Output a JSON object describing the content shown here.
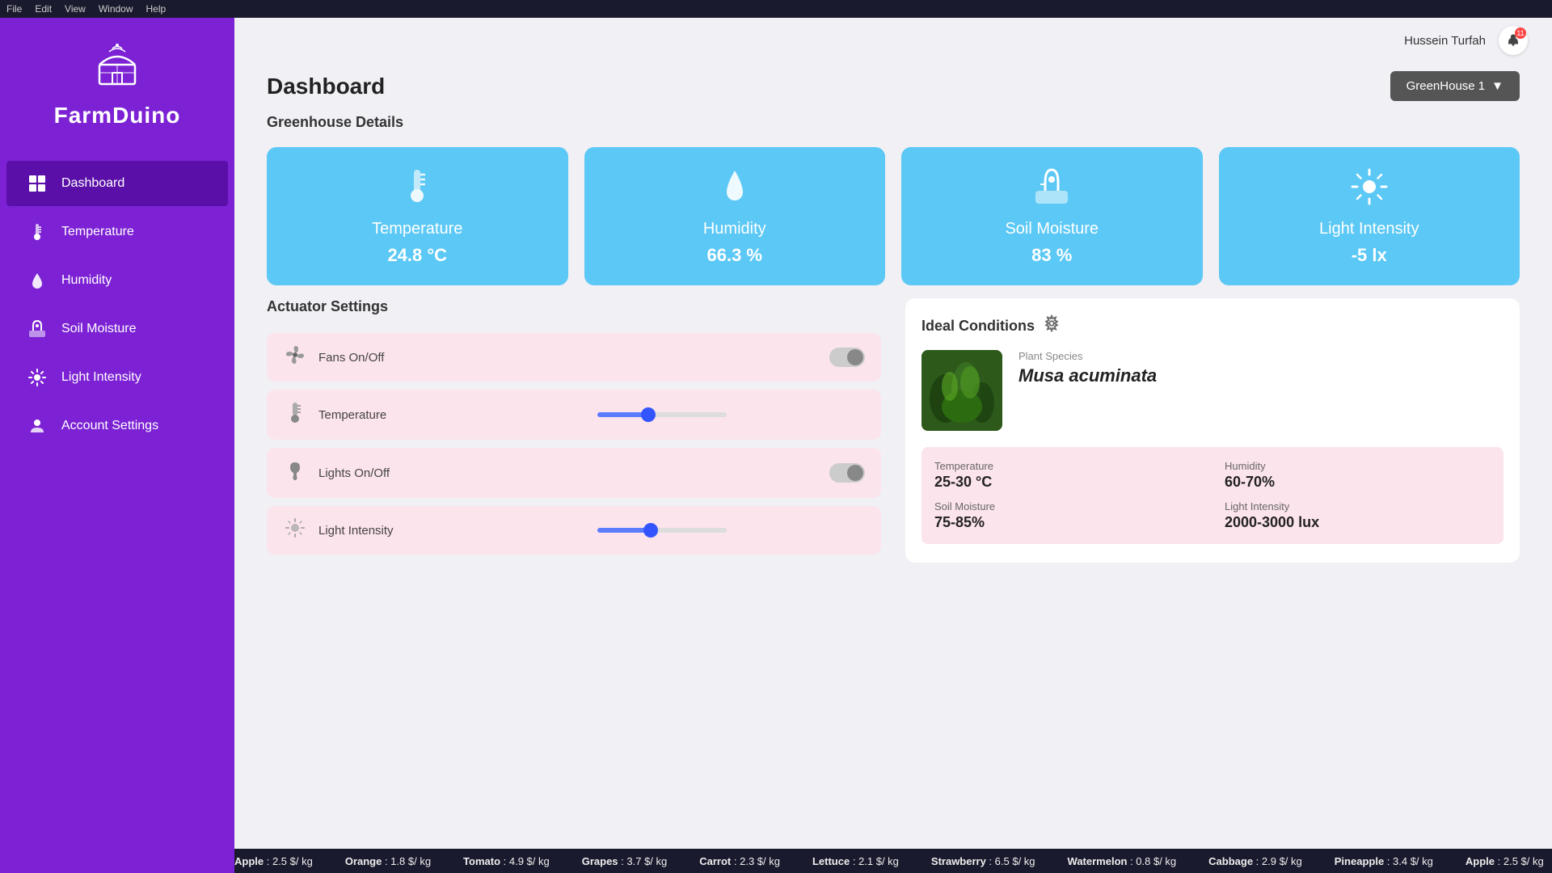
{
  "menubar": {
    "items": [
      "File",
      "Edit",
      "View",
      "Window",
      "Help"
    ]
  },
  "sidebar": {
    "logo_icon": "🏭",
    "logo_text": "FarmDuino",
    "nav_items": [
      {
        "id": "dashboard",
        "label": "Dashboard",
        "icon": "⊞",
        "active": true
      },
      {
        "id": "temperature",
        "label": "Temperature",
        "icon": "🌡",
        "active": false
      },
      {
        "id": "humidity",
        "label": "Humidity",
        "icon": "💧",
        "active": false
      },
      {
        "id": "soil-moisture",
        "label": "Soil Moisture",
        "icon": "🌱",
        "active": false
      },
      {
        "id": "light-intensity",
        "label": "Light Intensity",
        "icon": "💡",
        "active": false
      },
      {
        "id": "account-settings",
        "label": "Account Settings",
        "icon": "👤",
        "active": false
      }
    ]
  },
  "topbar": {
    "user_name": "Hussein Turfah",
    "notifications_count": "11"
  },
  "dashboard": {
    "page_title": "Dashboard",
    "greenhouse_selector": "GreenHouse 1",
    "greenhouse_details_title": "Greenhouse Details",
    "metric_cards": [
      {
        "id": "temperature",
        "label": "Temperature",
        "value": "24.8 °C",
        "icon": "🌡"
      },
      {
        "id": "humidity",
        "label": "Humidity",
        "value": "66.3 %",
        "icon": "💧"
      },
      {
        "id": "soil-moisture",
        "label": "Soil Moisture",
        "value": "83 %",
        "icon": "🌿"
      },
      {
        "id": "light-intensity",
        "label": "Light Intensity",
        "value": "-5 lx",
        "icon": "☀"
      }
    ],
    "actuator_settings_title": "Actuator Settings",
    "actuator_controls": [
      {
        "id": "fans",
        "label": "Fans On/Off",
        "type": "toggle",
        "icon": "fan"
      },
      {
        "id": "temperature-ctrl",
        "label": "Temperature",
        "type": "slider",
        "icon": "thermometer",
        "value": 38
      },
      {
        "id": "lights",
        "label": "Lights On/Off",
        "type": "toggle",
        "icon": "bulb"
      },
      {
        "id": "light-intensity-ctrl",
        "label": "Light Intensity",
        "type": "slider",
        "icon": "sun",
        "value": 40
      }
    ],
    "ideal_conditions_title": "Ideal Conditions",
    "plant_species_label": "Plant Species",
    "plant_species_name": "Musa acuminata",
    "conditions": [
      {
        "id": "temp",
        "label": "Temperature",
        "value": "25-30 °C"
      },
      {
        "id": "humidity",
        "label": "Humidity",
        "value": "60-70%"
      },
      {
        "id": "soil",
        "label": "Soil Moisture",
        "value": "75-85%"
      },
      {
        "id": "light",
        "label": "Light Intensity",
        "value": "2000-3000 lux"
      }
    ]
  },
  "ticker": {
    "items": [
      {
        "name": "Apple",
        "price": "2.5 $/ kg"
      },
      {
        "name": "Orange",
        "price": "1.8 $/ kg"
      },
      {
        "name": "Tomato",
        "price": "4.9 $/ kg"
      },
      {
        "name": "Grapes",
        "price": "3.7 $/ kg"
      },
      {
        "name": "Carrot",
        "price": "2.3 $/ kg"
      },
      {
        "name": "Lettuce",
        "price": "2.1 $/ kg"
      },
      {
        "name": "Strawberry",
        "price": "6.5 $/ kg"
      },
      {
        "name": "Watermelon",
        "price": "0.8 $/ kg"
      },
      {
        "name": "Cabbage",
        "price": "2.9 $/ kg"
      },
      {
        "name": "Pineapple",
        "price": "3.4 $/ kg"
      }
    ]
  }
}
